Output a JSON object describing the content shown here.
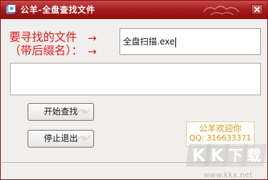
{
  "window": {
    "title": "公羊-全盘查找文件"
  },
  "form": {
    "label_line1": "要寻找的文件",
    "label_line2": "（带后缀名）：",
    "arrow1": "→",
    "arrow2": "→",
    "filename_value": "全盘扫描.exe"
  },
  "buttons": {
    "start_label": "开始查找",
    "stop_label": "停止退出"
  },
  "welcome": {
    "line1": "公羊欢迎你",
    "line2": "QQ: 316633371"
  },
  "watermark": {
    "logo_letters": [
      "K",
      "K",
      "下",
      "载"
    ],
    "url": "www.kkx.net"
  },
  "colors": {
    "title_bar": "#a61e1e",
    "label_red": "#e01919",
    "welcome_gold": "#d49a1c"
  }
}
